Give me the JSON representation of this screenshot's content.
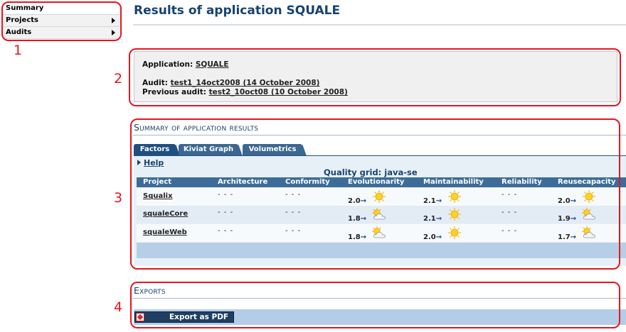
{
  "menu": {
    "items": [
      {
        "label": "Summary"
      },
      {
        "label": "Projects"
      },
      {
        "label": "Audits"
      }
    ]
  },
  "page_title": "Results of application SQUALE",
  "info": {
    "application_label": "Application:",
    "application_link": "SQUALE",
    "audit_label": "Audit:",
    "audit_link": "test1_14oct2008 (14 October 2008)",
    "previous_audit_label": "Previous audit:",
    "previous_audit_link": "test2_10oct08 (10 October 2008)"
  },
  "summary_section": {
    "title": "Summary of application results",
    "tabs": [
      "Factors",
      "Kiviat Graph",
      "Volumetrics"
    ],
    "help_label": "Help",
    "quality_grid": "Quality grid: java-se",
    "columns": [
      "Project",
      "Architecture",
      "Conformity",
      "Evolutionarity",
      "Maintainability",
      "Reliability",
      "Reusecapacity"
    ],
    "rows": [
      {
        "project": "Squalix",
        "architecture": "- - -",
        "conformity": "- - -",
        "evolutionarity": {
          "value": "2.0",
          "weather": "sun"
        },
        "maintainability": {
          "value": "2.1",
          "weather": "sun"
        },
        "reliability": "- - -",
        "reusecapacity": {
          "value": "2.0",
          "weather": "sun"
        }
      },
      {
        "project": "squaleCore",
        "architecture": "- - -",
        "conformity": "- - -",
        "evolutionarity": {
          "value": "1.8",
          "weather": "sun-cloud"
        },
        "maintainability": {
          "value": "2.1",
          "weather": "sun"
        },
        "reliability": "- - -",
        "reusecapacity": {
          "value": "1.9",
          "weather": "sun-cloud"
        }
      },
      {
        "project": "squaleWeb",
        "architecture": "- - -",
        "conformity": "- - -",
        "evolutionarity": {
          "value": "1.8",
          "weather": "sun-cloud"
        },
        "maintainability": {
          "value": "2.0",
          "weather": "sun"
        },
        "reliability": "- - -",
        "reusecapacity": {
          "value": "1.7",
          "weather": "sun-cloud"
        }
      }
    ],
    "arrow_glyph": "→"
  },
  "exports_section": {
    "title": "Exports",
    "pdf_button": "Export as PDF"
  },
  "callouts": [
    "1",
    "2",
    "3",
    "4"
  ],
  "colors": {
    "accent": "#16436e",
    "callout": "#e8141e",
    "tab": "#3b6791",
    "grid_header": "#3d6c99"
  }
}
